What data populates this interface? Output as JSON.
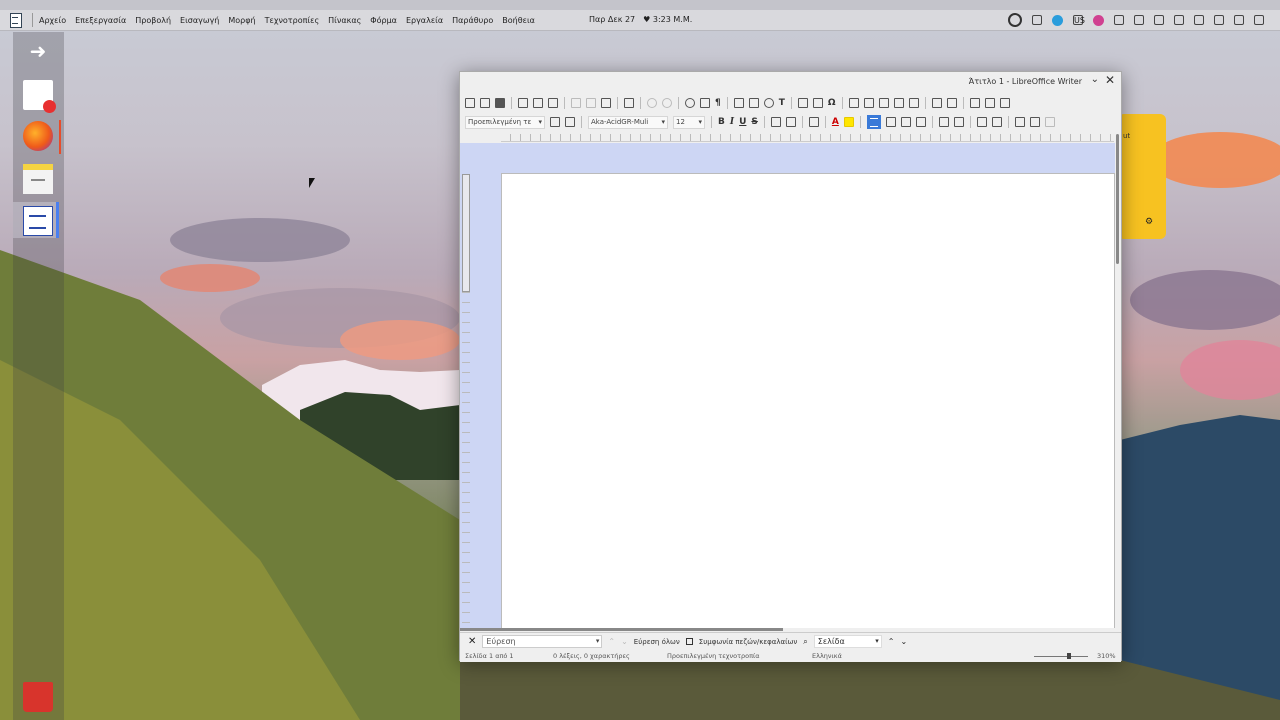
{
  "menu": {
    "items": [
      "Αρχείο",
      "Επεξεργασία",
      "Προβολή",
      "Εισαγωγή",
      "Μορφή",
      "Τεχνοτροπίες",
      "Πίνακας",
      "Φόρμα",
      "Εργαλεία",
      "Παράθυρο",
      "Βοήθεια"
    ]
  },
  "clock": {
    "date": "Παρ Δεκ 27",
    "time": "♥ 3:23 Μ.Μ."
  },
  "tray": {
    "keyboard_layout": "US"
  },
  "dock": {
    "items": [
      "arrow-icon",
      "notes-icon",
      "firefox-icon",
      "files-icon",
      "writer-icon",
      "trash-icon"
    ],
    "active": "writer-icon"
  },
  "sticky": {
    "text": "ut"
  },
  "window": {
    "title": "Άτιτλο 1 - LibreOffice Writer",
    "paragraph_style": "Προεπιλεγμένη τε",
    "font_name": "Aka-AcidGR-Muli",
    "font_size": "12",
    "accent": "#3a7ad8"
  },
  "findbar": {
    "search_placeholder": "Εύρεση",
    "find_all": "Εύρεση όλων",
    "match_case": "Συμφωνία πεζών/κεφαλαίων",
    "navigate_by": "Σελίδα"
  },
  "status": {
    "page": "Σελίδα 1 από 1",
    "words": "0 λέξεις, 0 χαρακτήρες",
    "page_style": "Προεπιλεγμένη τεχνοτροπία",
    "language": "Ελληνικά",
    "zoom": "310%"
  }
}
